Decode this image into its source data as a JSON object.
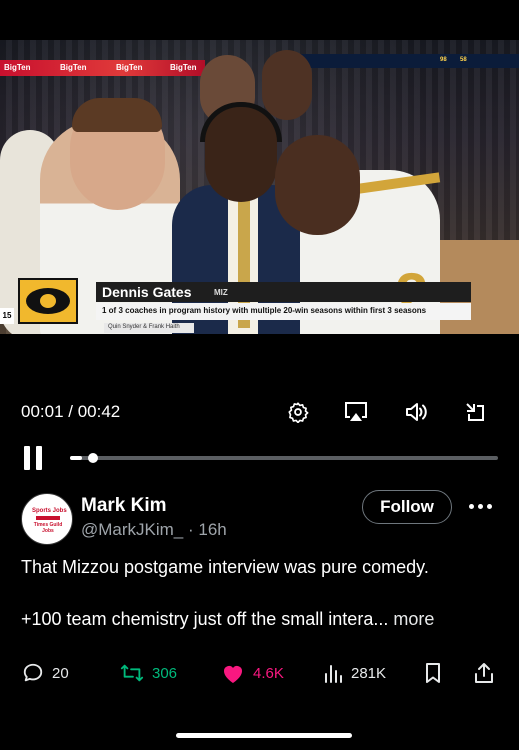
{
  "video": {
    "board_left": [
      "BigTen",
      "BigTen",
      "BigTen",
      "BigTen"
    ],
    "board_right": [
      "98",
      "58"
    ],
    "jersey_number": "2",
    "lower_third": {
      "badge_number": "15",
      "name": "Dennis Gates",
      "school": "MIZ",
      "info": "1 of 3 coaches in program history with multiple 20-win seasons within first 3 seasons",
      "sub": "Quin Snyder & Frank Haith"
    }
  },
  "player": {
    "time": "00:01 / 00:42",
    "progress": 0.027,
    "icons": [
      "settings-gear-icon",
      "airplay-icon",
      "volume-icon",
      "exit-fullscreen-icon"
    ]
  },
  "post": {
    "avatar": {
      "line1": "Sports Jobs",
      "line2": "Times Guild Jobs"
    },
    "author": "Mark Kim",
    "handle": "@MarkJKim_ · 16h",
    "follow_label": "Follow",
    "text_line1": "That Mizzou postgame interview was pure comedy.",
    "text_line2": "+100 team chemistry just off the small intera...",
    "more_label": "more"
  },
  "actions": {
    "replies": "20",
    "reposts": "306",
    "likes": "4.6K",
    "views": "281K"
  },
  "colors": {
    "repost": "#00ba7c",
    "like": "#f91880",
    "muted": "#9ea4aa"
  }
}
